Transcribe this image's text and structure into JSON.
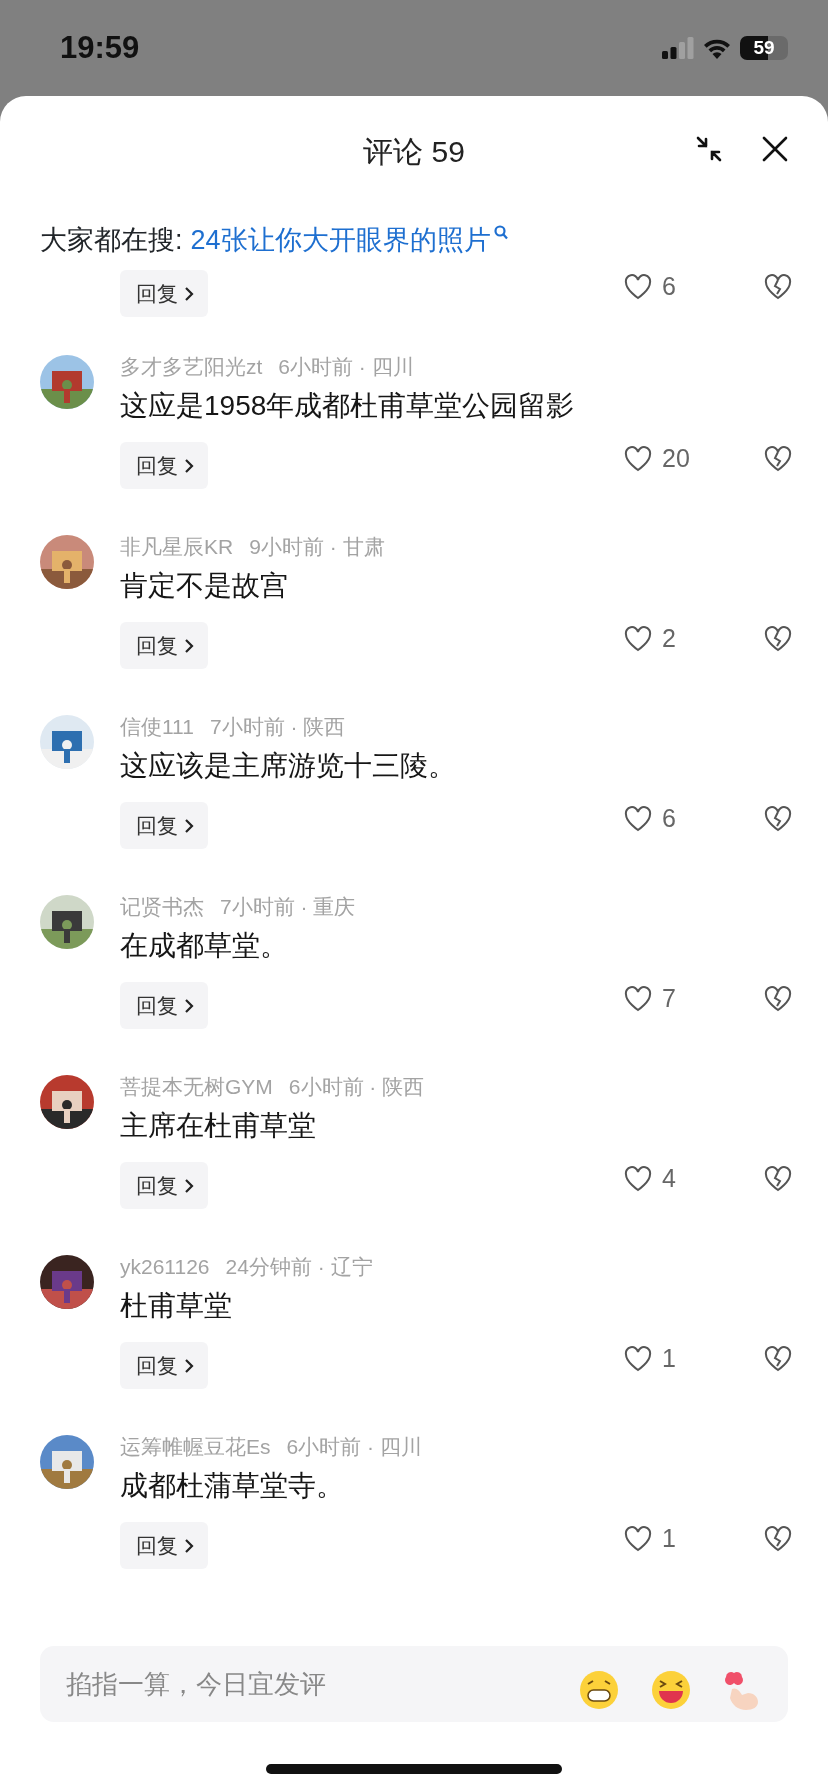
{
  "status_bar": {
    "time": "19:59",
    "battery": "59"
  },
  "sheet": {
    "title": "评论 59"
  },
  "trending": {
    "label": "大家都在搜:",
    "query": "24张让你大开眼界的照片"
  },
  "partial_comment": {
    "reply_label": "回复",
    "likes": "6"
  },
  "comments": [
    {
      "user": "多才多艺阳光zt",
      "posted": "6小时前 · 四川",
      "text": "这应是1958年成都杜甫草堂公园留影",
      "reply_label": "回复",
      "likes": "20"
    },
    {
      "user": "非凡星辰KR",
      "posted": "9小时前 · 甘肃",
      "text": "肯定不是故宫",
      "reply_label": "回复",
      "likes": "2"
    },
    {
      "user": "信使111",
      "posted": "7小时前 · 陕西",
      "text": "这应该是主席游览十三陵。",
      "reply_label": "回复",
      "likes": "6"
    },
    {
      "user": "记贤书杰",
      "posted": "7小时前 · 重庆",
      "text": "在成都草堂。",
      "reply_label": "回复",
      "likes": "7"
    },
    {
      "user": "菩提本无树GYM",
      "posted": "6小时前 · 陕西",
      "text": "主席在杜甫草堂",
      "reply_label": "回复",
      "likes": "4"
    },
    {
      "user": "yk261126",
      "posted": "24分钟前 · 辽宁",
      "text": "杜甫草堂",
      "reply_label": "回复",
      "likes": "1"
    },
    {
      "user": "运筹帷幄豆花Es",
      "posted": "6小时前 · 四川",
      "text": "成都杜蒲草堂寺。",
      "reply_label": "回复",
      "likes": "1"
    }
  ],
  "composer": {
    "placeholder": "掐指一算，今日宜发评"
  }
}
